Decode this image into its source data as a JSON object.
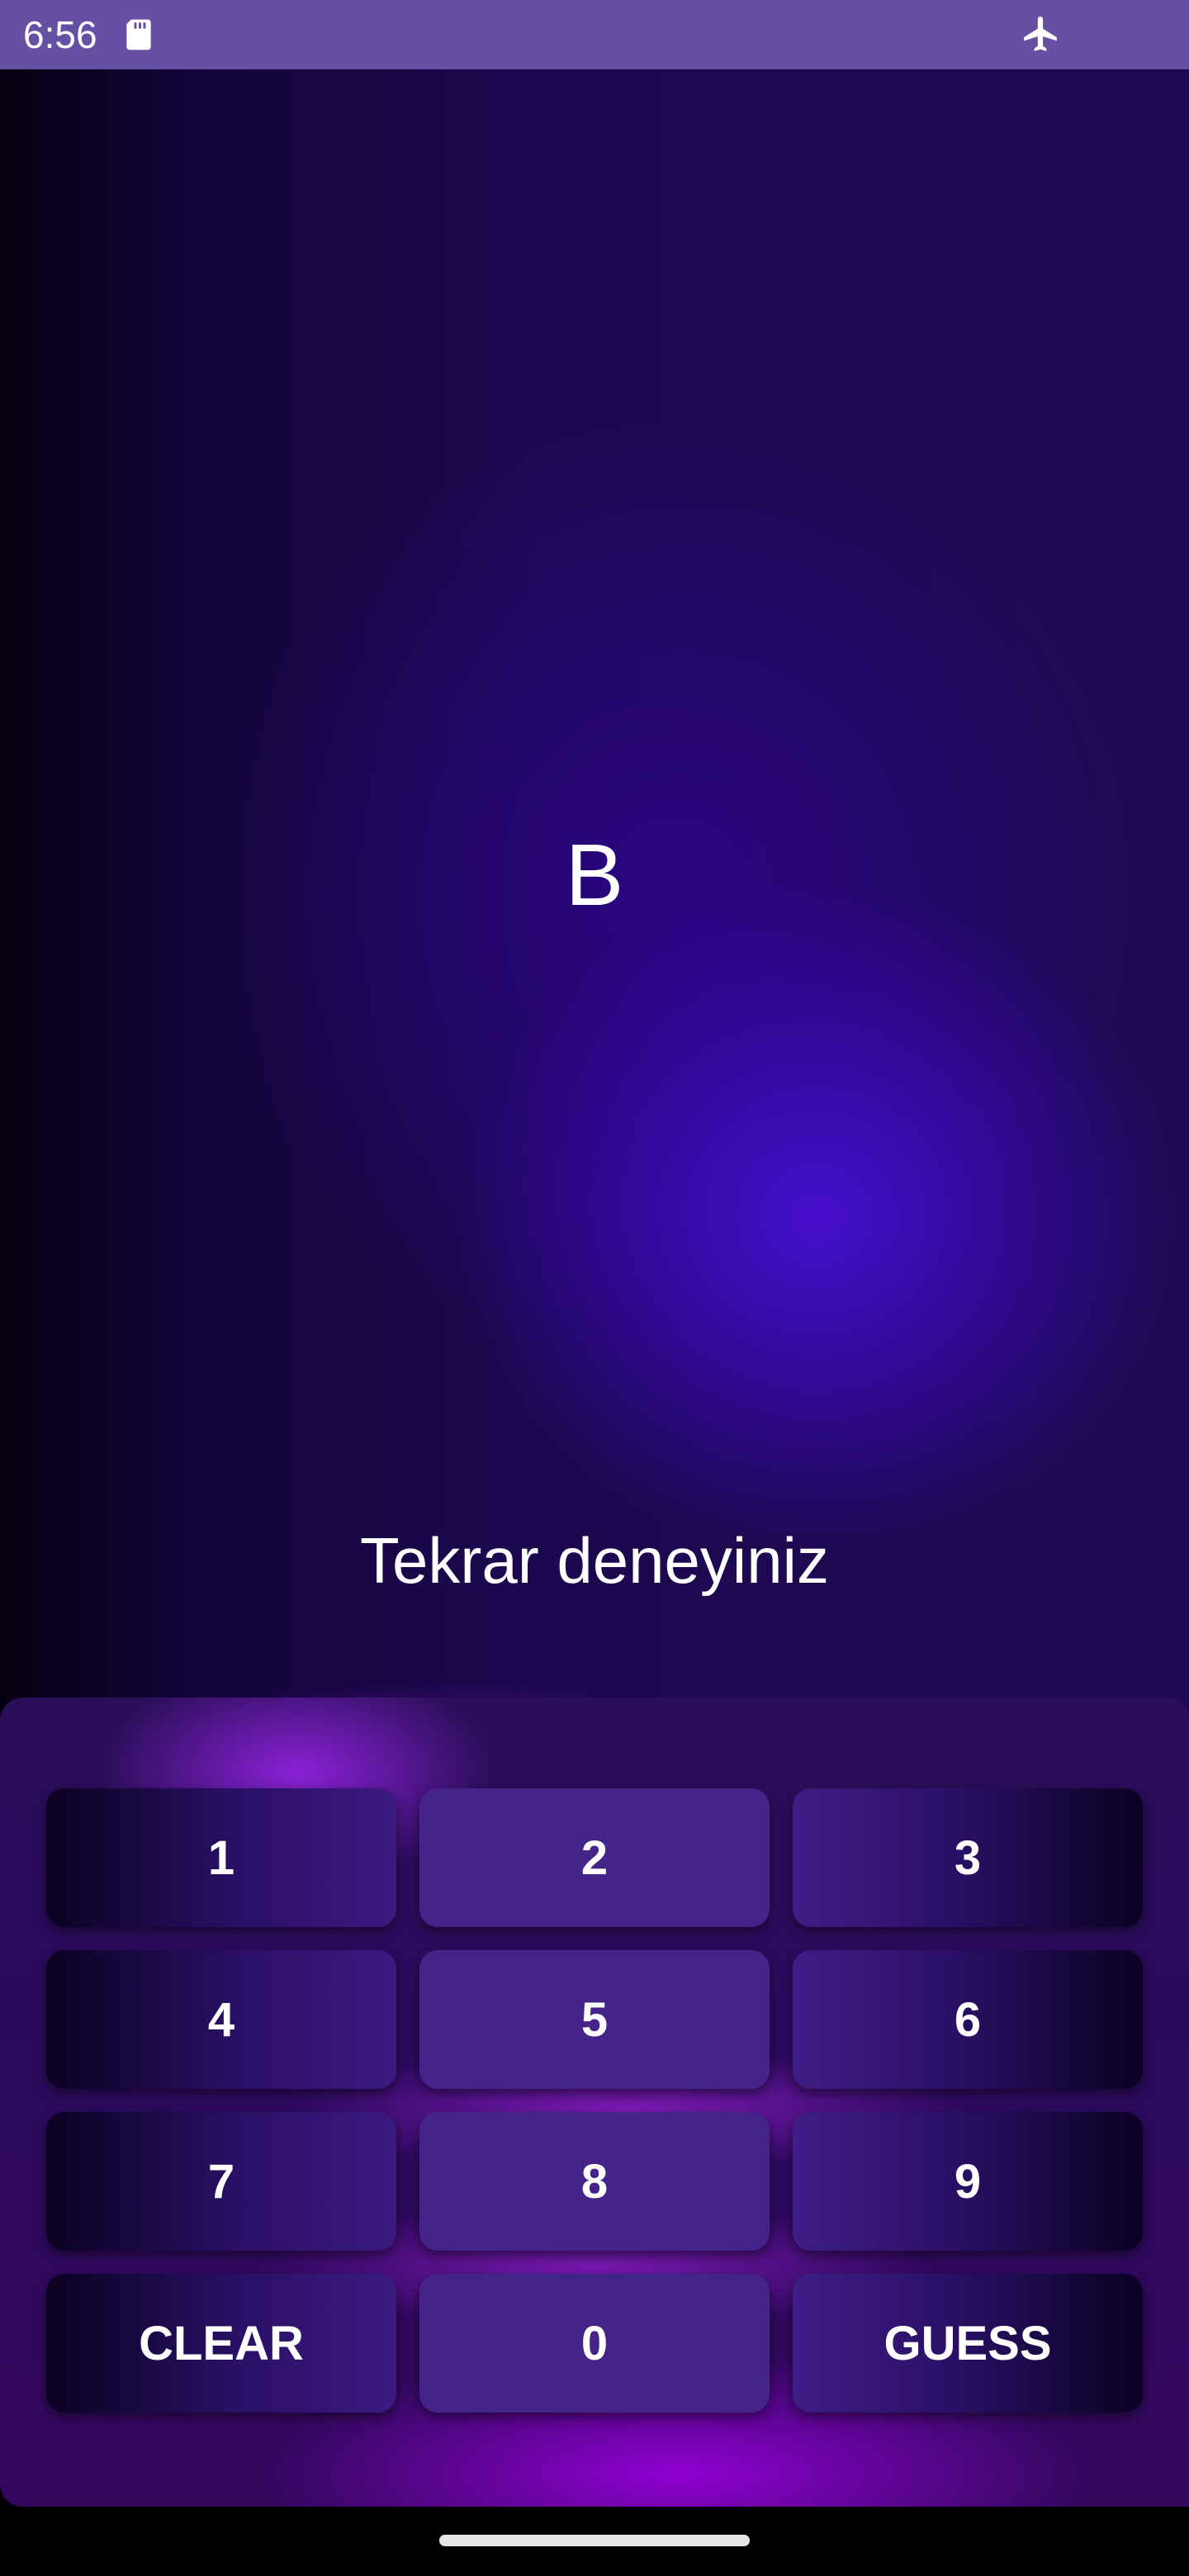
{
  "status_bar": {
    "time": "6:56",
    "icons": [
      "sd-card-icon",
      "airplane-mode-icon"
    ],
    "background_color": "#6650a4"
  },
  "game": {
    "current_letter": "B",
    "message": "Tekrar deneyiniz"
  },
  "keypad": {
    "keys": [
      {
        "label": "1"
      },
      {
        "label": "2"
      },
      {
        "label": "3"
      },
      {
        "label": "4"
      },
      {
        "label": "5"
      },
      {
        "label": "6"
      },
      {
        "label": "7"
      },
      {
        "label": "8"
      },
      {
        "label": "9"
      },
      {
        "label": "CLEAR"
      },
      {
        "label": "0"
      },
      {
        "label": "GUESS"
      }
    ]
  },
  "colors": {
    "accent_purple": "#452489",
    "background_dark": "#1f0a52",
    "glow_violet": "#8a14e6"
  }
}
